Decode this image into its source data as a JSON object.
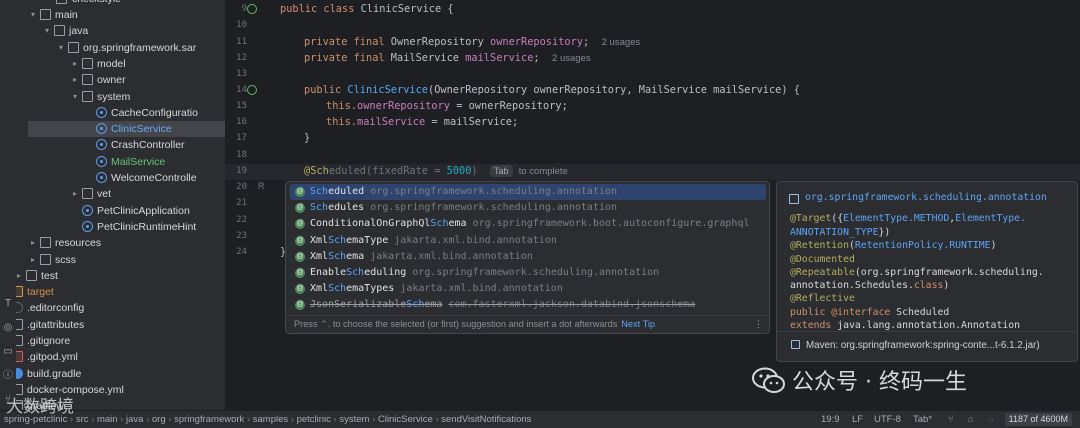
{
  "tree": {
    "top_partial": "checkstyle",
    "items": [
      {
        "label": "main",
        "kind": "folder",
        "arrow": "down"
      },
      {
        "label": "java",
        "kind": "folder",
        "arrow": "down"
      },
      {
        "label": "org.springframework.sar",
        "kind": "package",
        "arrow": "down"
      },
      {
        "label": "model",
        "kind": "package",
        "arrow": "right"
      },
      {
        "label": "owner",
        "kind": "package",
        "arrow": "right"
      },
      {
        "label": "system",
        "kind": "package",
        "arrow": "down"
      },
      {
        "label": "CacheConfiguratio",
        "kind": "class"
      },
      {
        "label": "ClinicService",
        "kind": "class",
        "selected": true
      },
      {
        "label": "CrashController",
        "kind": "class"
      },
      {
        "label": "MailService",
        "kind": "class"
      },
      {
        "label": "WelcomeControlle",
        "kind": "class"
      },
      {
        "label": "vet",
        "kind": "package",
        "arrow": "right"
      },
      {
        "label": "PetClinicApplication",
        "kind": "class"
      },
      {
        "label": "PetClinicRuntimeHint",
        "kind": "class"
      },
      {
        "label": "resources",
        "kind": "folder",
        "arrow": "right"
      },
      {
        "label": "scss",
        "kind": "folder",
        "arrow": "right"
      },
      {
        "label": "test",
        "kind": "folder",
        "arrow": "right"
      },
      {
        "label": "target",
        "kind": "folder-orange",
        "arrow": "right"
      },
      {
        "label": ".editorconfig",
        "kind": "gear"
      },
      {
        "label": ".gitattributes",
        "kind": "file"
      },
      {
        "label": ".gitignore",
        "kind": "file"
      },
      {
        "label": ".gitpod.yml",
        "kind": "file-red"
      },
      {
        "label": "build.gradle",
        "kind": "elephant"
      },
      {
        "label": "docker-compose.yml",
        "kind": "file"
      },
      {
        "label": "gradlew",
        "kind": "file"
      }
    ]
  },
  "editor": {
    "line_numbers": [
      "9",
      "10",
      "11",
      "12",
      "13",
      "14",
      "15",
      "16",
      "17",
      "18",
      "19",
      "20",
      "21",
      "22",
      "23",
      "24"
    ],
    "code": {
      "l9_kw": "public class ",
      "l9_name": "ClinicService",
      "l9_rest": " {",
      "l11_kw": "private final ",
      "l11_type": "OwnerRepository ",
      "l11_field": "ownerRepository",
      "l11_end": ";",
      "l11_hint": "2 usages",
      "l12_kw": "private final ",
      "l12_type": "MailService ",
      "l12_field": "mailService",
      "l12_end": ";",
      "l12_hint": "2 usages",
      "l14_kw": "public ",
      "l14_name": "ClinicService",
      "l14_rest": "(OwnerRepository ownerRepository, MailService mailService) {",
      "l15_this": "this.",
      "l15_field": "ownerRepository",
      "l15_rest": " = ownerRepository;",
      "l16_this": "this.",
      "l16_field": "mailService",
      "l16_rest": " = mailService;",
      "l17": "}",
      "l19_typed": "@Sch",
      "l19_ghost": "eduled",
      "l19_paren": "(fixedRate = ",
      "l19_num": "5000",
      "l19_close": ")",
      "l19_tab": "Tab",
      "l19_hint": "to complete",
      "l24": "}"
    }
  },
  "completion": {
    "items": [
      {
        "match": "Sch",
        "rest": "eduled",
        "package": "org.springframework.scheduling.annotation",
        "selected": true
      },
      {
        "match": "Sch",
        "rest": "edules",
        "package": "org.springframework.scheduling.annotation"
      },
      {
        "pre": "ConditionalOnGraphQl",
        "match": "Sch",
        "rest": "ema",
        "package": "org.springframework.boot.autoconfigure.graphql"
      },
      {
        "pre": "Xml",
        "match": "Sch",
        "rest": "emaType",
        "package": "jakarta.xml.bind.annotation"
      },
      {
        "pre": "Xml",
        "match": "Sch",
        "rest": "ema",
        "package": "jakarta.xml.bind.annotation"
      },
      {
        "pre": "Enable",
        "match": "Sch",
        "rest": "eduling",
        "package": "org.springframework.scheduling.annotation"
      },
      {
        "pre": "Xml",
        "match": "Sch",
        "rest": "emaTypes",
        "package": "jakarta.xml.bind.annotation"
      },
      {
        "pre": "JsonSerializable",
        "match": "Sch",
        "rest": "ema",
        "package": "com.fasterxml.jackson.databind.jsonschema",
        "deprecated": true
      }
    ],
    "footer": "Press ⌃. to choose the selected (or first) suggestion and insert a dot afterwards",
    "next_tip": "Next Tip",
    "more": "⋮"
  },
  "doc": {
    "package": "org.springframework.scheduling.annotation",
    "l1": [
      "@Target",
      "({",
      "ElementType.METHOD",
      ",",
      "ElementType."
    ],
    "l2": [
      "ANNOTATION_TYPE",
      "})"
    ],
    "l3": [
      "@Retention",
      "(",
      "RetentionPolicy.RUNTIME",
      ")"
    ],
    "l4": "@Documented",
    "l5": [
      "@Repeatable",
      "(org.springframework.scheduling."
    ],
    "l6": [
      "annotation.Schedules.",
      "class",
      ")"
    ],
    "l7": "@Reflective",
    "l8": [
      "public @interface",
      " Scheduled"
    ],
    "l9": [
      "extends",
      " java.lang.annotation.Annotation"
    ],
    "maven": "Maven: org.springframework:spring-conte...t-6.1.2.jar)"
  },
  "status": {
    "crumbs": [
      "spring-petclinic",
      "src",
      "main",
      "java",
      "org",
      "springframework",
      "samples",
      "petclinic",
      "system",
      "ClinicService",
      "sendVisitNotifications"
    ],
    "position": "19:9",
    "line_sep": "LF",
    "encoding": "UTF-8",
    "indent": "Tab*",
    "memory": "1187 of 4600M"
  },
  "watermark": {
    "main": "公众号 · 终码一生",
    "corner": "大数跨境"
  }
}
